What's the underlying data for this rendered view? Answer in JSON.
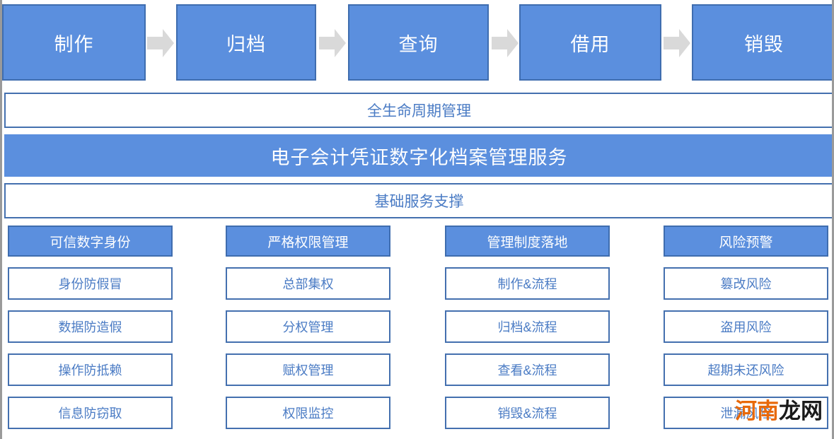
{
  "colors": {
    "accent_fill": "#5B8FDE",
    "accent_border": "#3F6DAF",
    "outline_border": "#4470AF",
    "outline_text": "#4A7BC4",
    "arrow_gray": "#D9D9D9",
    "page_edge": "#9A9A9A",
    "watermark_orange": "#E8690B",
    "watermark_dark": "#1A1A1A"
  },
  "flow": {
    "arrow_icon": "right-arrow-icon",
    "stages": [
      {
        "label": "制作"
      },
      {
        "label": "归档"
      },
      {
        "label": "查询"
      },
      {
        "label": "借用"
      },
      {
        "label": "销毁"
      }
    ]
  },
  "bars": {
    "lifecycle": "全生命周期管理",
    "service": "电子会计凭证数字化档案管理服务",
    "support": "基础服务支撑"
  },
  "pillars": [
    {
      "title": "可信数字身份",
      "items": [
        "身份防假冒",
        "数据防造假",
        "操作防抵赖",
        "信息防窃取"
      ]
    },
    {
      "title": "严格权限管理",
      "items": [
        "总部集权",
        "分权管理",
        "赋权管理",
        "权限监控"
      ]
    },
    {
      "title": "管理制度落地",
      "items": [
        "制作&流程",
        "归档&流程",
        "查看&流程",
        "销毁&流程"
      ]
    },
    {
      "title": "风险预警",
      "items": [
        "篡改风险",
        "盗用风险",
        "超期未还风险",
        "泄漏风险"
      ]
    }
  ],
  "watermark": {
    "part1": "河南",
    "part2": "龙网"
  }
}
